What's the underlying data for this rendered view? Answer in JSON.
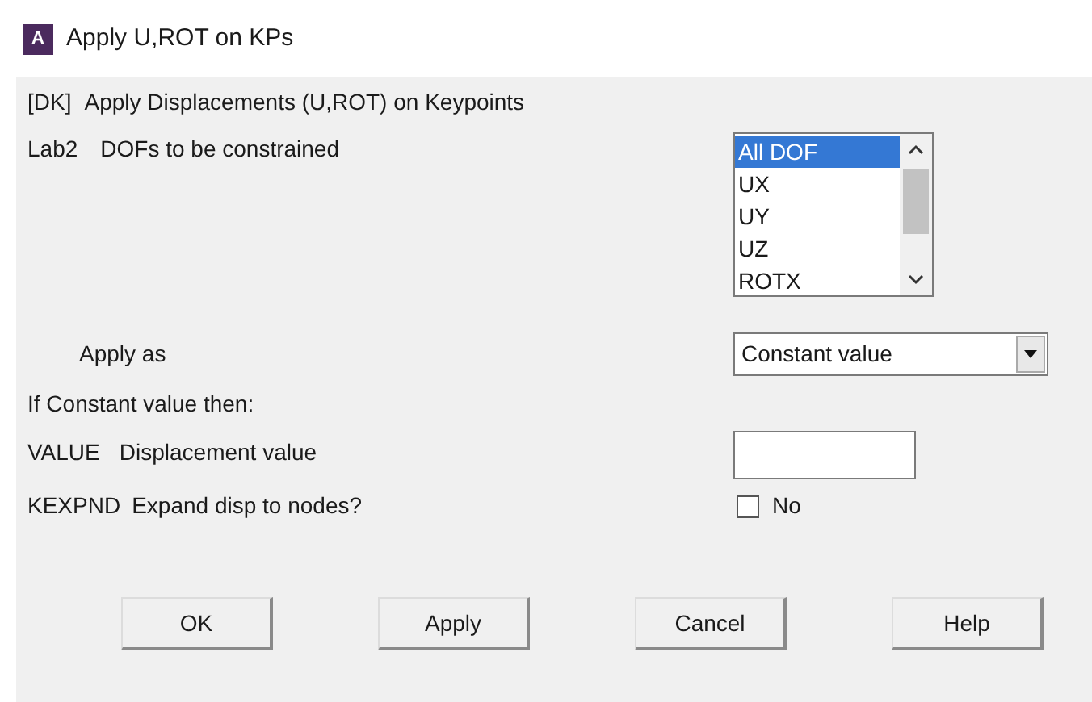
{
  "window": {
    "title": "Apply U,ROT on KPs",
    "app_icon_letter": "A"
  },
  "heading": {
    "code": "[DK]",
    "text": "Apply Displacements (U,ROT) on Keypoints"
  },
  "dofs": {
    "code": "Lab2",
    "label": "DOFs to be constrained",
    "options": [
      {
        "label": "All DOF",
        "selected": true
      },
      {
        "label": "UX",
        "selected": false
      },
      {
        "label": "UY",
        "selected": false
      },
      {
        "label": "UZ",
        "selected": false
      },
      {
        "label": "ROTX",
        "selected": false
      }
    ]
  },
  "apply_as": {
    "label": "Apply as",
    "value": "Constant value"
  },
  "note": "If Constant value then:",
  "value_field": {
    "code": "VALUE",
    "label": "Displacement value"
  },
  "kexpnd": {
    "code": "KEXPND",
    "label": "Expand disp to nodes?",
    "checked": false,
    "text": "No"
  },
  "buttons": [
    "OK",
    "Apply",
    "Cancel",
    "Help"
  ]
}
